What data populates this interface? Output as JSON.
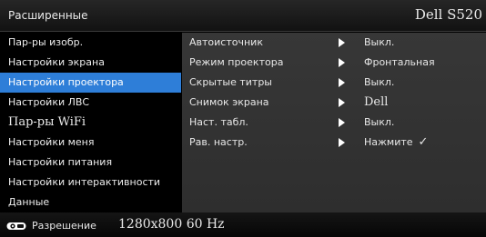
{
  "header": {
    "title": "Расширенные",
    "model": "Dell S520"
  },
  "sidebar": {
    "items": [
      {
        "label": "Пар-ры изобр."
      },
      {
        "label": "Настройки экрана"
      },
      {
        "label": "Настройки проектора",
        "active": true
      },
      {
        "label": "Настройки ЛВС"
      },
      {
        "label": "Пар-ры WiFi"
      },
      {
        "label": "Настройки меня"
      },
      {
        "label": "Настройки питания"
      },
      {
        "label": "Настройки интерактивности"
      },
      {
        "label": "Данные"
      }
    ]
  },
  "panel": {
    "rows": [
      {
        "label": "Автоисточник",
        "value": "Выкл."
      },
      {
        "label": "Режим проектора",
        "value": "Фронтальная"
      },
      {
        "label": "Скрытые титры",
        "value": "Выкл."
      },
      {
        "label": "Снимок экрана",
        "value": "Dell"
      },
      {
        "label": "Наст. табл.",
        "value": "Выкл."
      },
      {
        "label": "Рав. настр.",
        "value": "Нажмите",
        "check": "✓"
      }
    ]
  },
  "footer": {
    "label": "Разрешение",
    "value": "1280x800 60 Hz",
    "icon": "projector-icon"
  }
}
